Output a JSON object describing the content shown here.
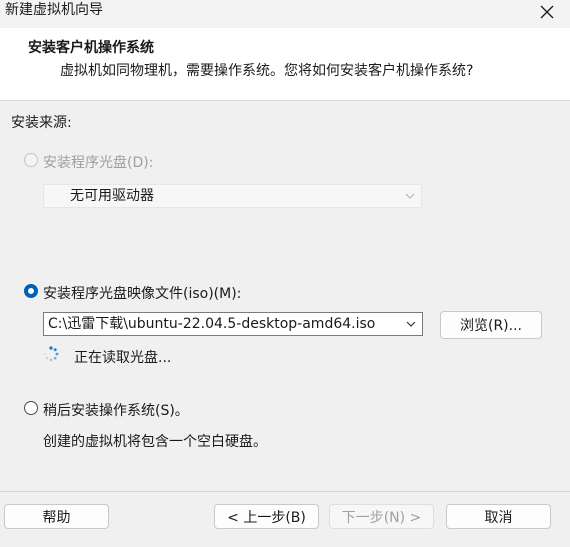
{
  "window": {
    "title": "新建虚拟机向导"
  },
  "header": {
    "title": "安装客户机操作系统",
    "description": "虚拟机如同物理机，需要操作系统。您将如何安装客户机操作系统?"
  },
  "source_label": "安装来源:",
  "options": {
    "disc": {
      "label": "安装程序光盘(D):",
      "selected": false,
      "enabled": false,
      "drive_value": "无可用驱动器"
    },
    "iso": {
      "label": "安装程序光盘映像文件(iso)(M):",
      "selected": true,
      "path_value": "C:\\迅雷下载\\ubuntu-22.04.5-desktop-amd64.iso",
      "browse_label": "浏览(R)...",
      "status_text": "正在读取光盘..."
    },
    "later": {
      "label": "稍后安装操作系统(S)。",
      "selected": false,
      "note": "创建的虚拟机将包含一个空白硬盘。"
    }
  },
  "footer": {
    "help": "帮助",
    "back": "< 上一步(B)",
    "next": "下一步(N) >",
    "cancel": "取消"
  },
  "colors": {
    "accent": "#005fb8",
    "disabled_text": "#a0a0a0"
  },
  "icons": {
    "close": "close-icon",
    "dropdown": "chevron-down-icon",
    "loading": "spinner-icon"
  }
}
